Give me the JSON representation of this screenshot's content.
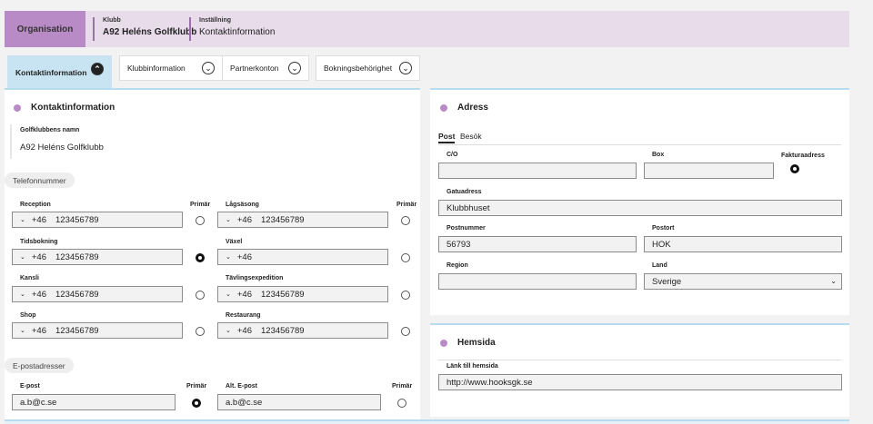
{
  "header": {
    "org_label": "Organisation",
    "club_label": "Klubb",
    "club_value": "A92 Heléns Golfklubb",
    "setting_label": "Inställning",
    "setting_value": "Kontaktinformation"
  },
  "tabs": [
    {
      "label": "Kontaktinformation",
      "icon": "chevron-up-icon",
      "active": true
    },
    {
      "label": "Klubbinformation",
      "icon": "chevron-down-icon"
    },
    {
      "label": "Partnerkonton",
      "icon": "chevron-down-icon"
    },
    {
      "label": "Bokningsbehörighet",
      "icon": "chevron-down-icon"
    }
  ],
  "contact": {
    "title": "Kontaktinformation",
    "club_name_label": "Golfklubbens namn",
    "club_name_value": "A92 Heléns Golfklubb",
    "phone_section": "Telefonnummer",
    "primary_label": "Primär",
    "phones": [
      {
        "label": "Reception",
        "cc": "+46",
        "number": "123456789",
        "primary": false
      },
      {
        "label": "Lågsäsong",
        "cc": "+46",
        "number": "123456789",
        "primary": false
      },
      {
        "label": "Tidsbokning",
        "cc": "+46",
        "number": "123456789",
        "primary": true
      },
      {
        "label": "Växel",
        "cc": "+46",
        "number": "",
        "primary": false
      },
      {
        "label": "Kansli",
        "cc": "+46",
        "number": "123456789",
        "primary": false
      },
      {
        "label": "Tävlingsexpedition",
        "cc": "+46",
        "number": "123456789",
        "primary": false
      },
      {
        "label": "Shop",
        "cc": "+46",
        "number": "123456789",
        "primary": false
      },
      {
        "label": "Restaurang",
        "cc": "+46",
        "number": "123456789",
        "primary": false
      }
    ],
    "email_section": "E-postadresser",
    "emails": [
      {
        "label": "E-post",
        "value": "a.b@c.se",
        "primary": true
      },
      {
        "label": "Alt. E-post",
        "value": "a.b@c.se",
        "primary": false
      }
    ]
  },
  "address": {
    "title": "Adress",
    "tab_post": "Post",
    "tab_visit": "Besök",
    "co_label": "C/O",
    "co_value": "",
    "box_label": "Box",
    "box_value": "",
    "invoice_label": "Fakturaadress",
    "street_label": "Gatuadress",
    "street_value": "Klubbhuset",
    "zip_label": "Postnummer",
    "zip_value": "56793",
    "city_label": "Postort",
    "city_value": "HOK",
    "region_label": "Region",
    "region_value": "",
    "country_label": "Land",
    "country_value": "Sverige"
  },
  "website": {
    "title": "Hemsida",
    "link_label": "Länk till hemsida",
    "link_value": "http://www.hooksgk.se"
  },
  "colors": {
    "accent": "#b98bc6",
    "header_bg": "#e8dceb",
    "tab_active": "#c8e3f2"
  }
}
